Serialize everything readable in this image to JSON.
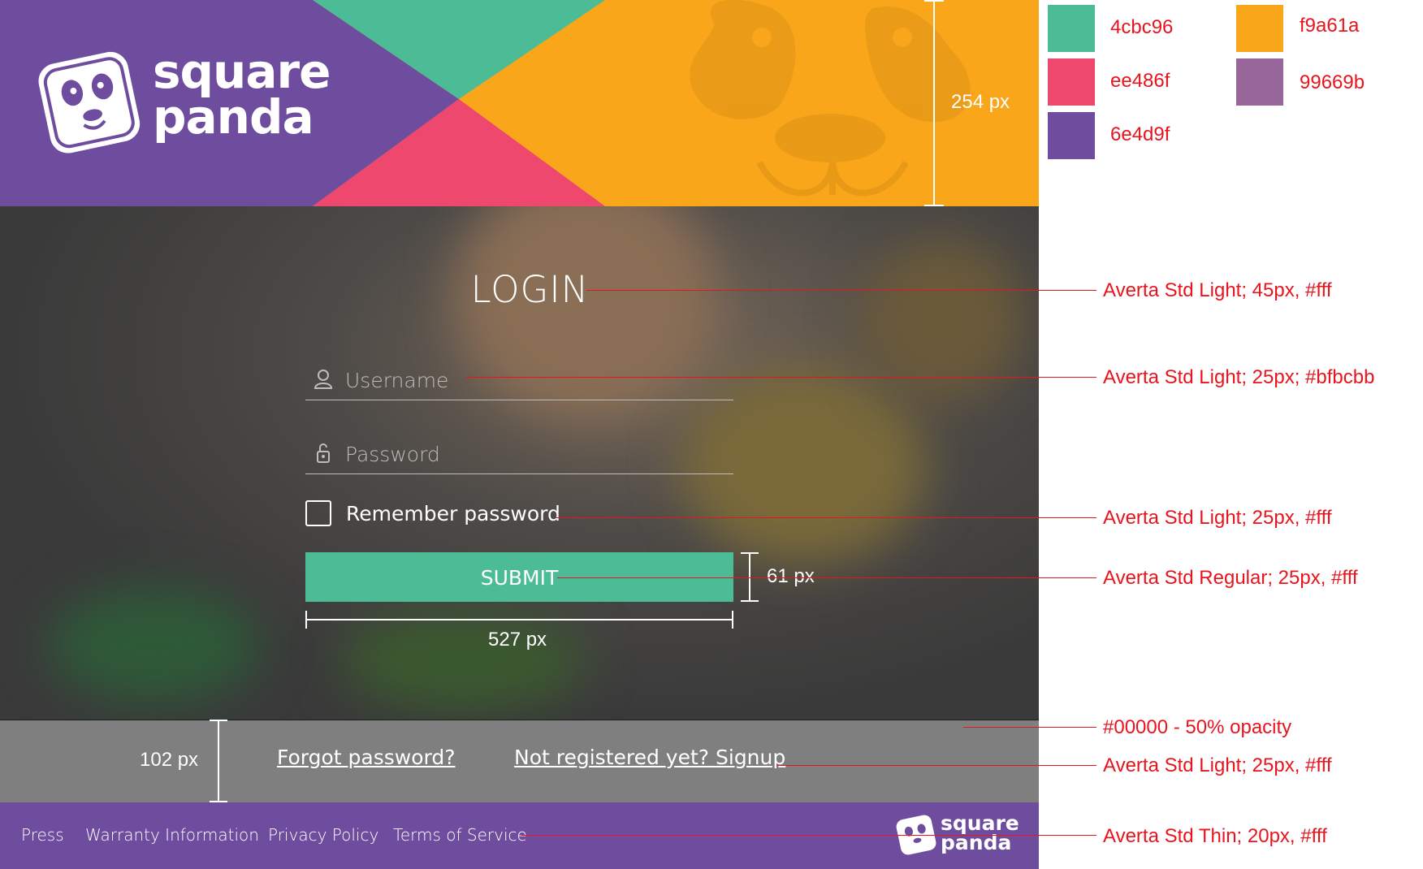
{
  "brand": {
    "name_line1": "square",
    "name_line2": "panda",
    "colors": {
      "green": "#4cbc96",
      "orange": "#f9a61a",
      "pink": "#ee486f",
      "mauve": "#99669b",
      "purple": "#6e4d9f"
    }
  },
  "login": {
    "title": "LOGIN",
    "username_placeholder": "Username",
    "password_placeholder": "Password",
    "remember_label": "Remember password",
    "submit_label": "SUBMIT",
    "forgot_link": "Forgot password?",
    "signup_link": "Not registered yet? Signup"
  },
  "footer": {
    "links": [
      "Press",
      "Warranty Information",
      "Privacy Policy",
      "Terms of Service"
    ]
  },
  "dimensions": {
    "header_height": "254 px",
    "button_height": "61 px",
    "button_width": "527 px",
    "bottom_bar_height": "102 px"
  },
  "swatches": [
    {
      "label": "4cbc96",
      "color": "#4cbc96"
    },
    {
      "label": "ee486f",
      "color": "#ee486f"
    },
    {
      "label": "6e4d9f",
      "color": "#6e4d9f"
    },
    {
      "label": "f9a61a",
      "color": "#f9a61a"
    },
    {
      "label": "99669b",
      "color": "#99669b"
    }
  ],
  "annotations": {
    "title": "Averta Std Light; 45px, #fff",
    "username": "Averta Std Light; 25px; #bfbcbb",
    "remember": "Averta Std Light; 25px, #fff",
    "submit": "Averta Std Regular; 25px, #fff",
    "overlay": "#00000 - 50% opacity",
    "bottom_links": "Averta Std Light; 25px, #fff",
    "footer_links": "Averta Std Thin; 20px, #fff"
  }
}
